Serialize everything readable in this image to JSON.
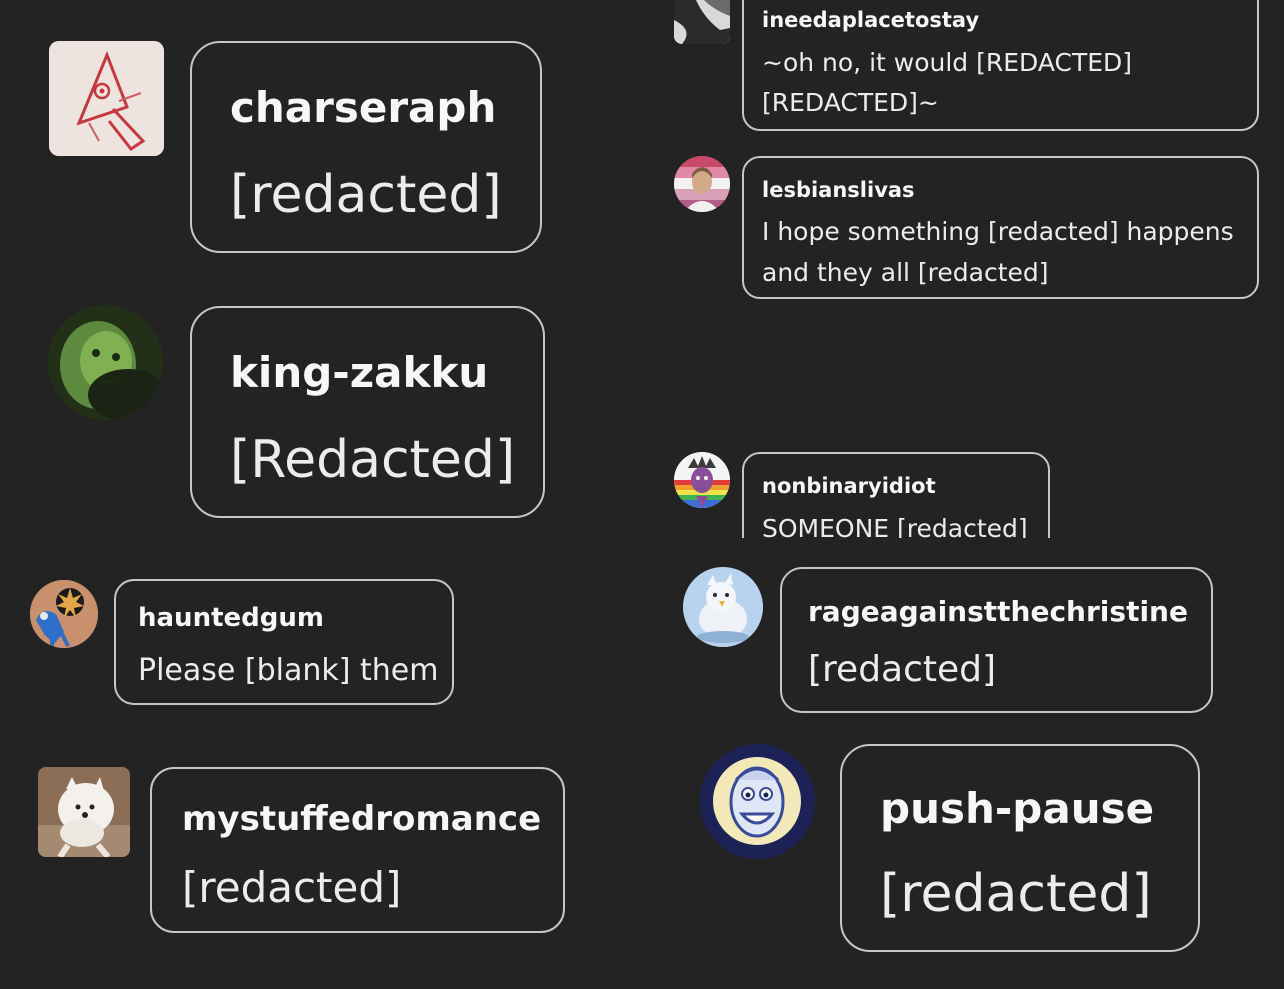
{
  "comments": [
    {
      "username": "charseraph",
      "message": "[redacted]",
      "avatar_icon": "red-sketch-icon"
    },
    {
      "username": "king-zakku",
      "message": "[Redacted]",
      "avatar_icon": "green-face-icon"
    },
    {
      "username": "hauntedgum",
      "message": "Please [blank] them",
      "avatar_icon": "blue-creature-icon"
    },
    {
      "username": "mystuffedromance",
      "message": "[redacted]",
      "avatar_icon": "white-dog-icon"
    },
    {
      "username": "ineedaplacetostay",
      "message_lines": [
        "~oh no, it would [REDACTED]",
        "[REDACTED]~"
      ],
      "avatar_icon": "grey-shape-icon"
    },
    {
      "username": "lesbianslivas",
      "message_lines": [
        "I hope something [redacted] happens",
        "and they all [redacted]"
      ],
      "avatar_icon": "person-portrait-icon"
    },
    {
      "username": "nonbinaryidiot",
      "message": "SOMEONE [redacted]",
      "avatar_icon": "rainbow-character-icon"
    },
    {
      "username": "rageagainstthechristine",
      "message": "[redacted]",
      "avatar_icon": "bird-plush-icon"
    },
    {
      "username": "push-pause",
      "message": "[redacted]",
      "avatar_icon": "cartoon-face-icon"
    }
  ]
}
